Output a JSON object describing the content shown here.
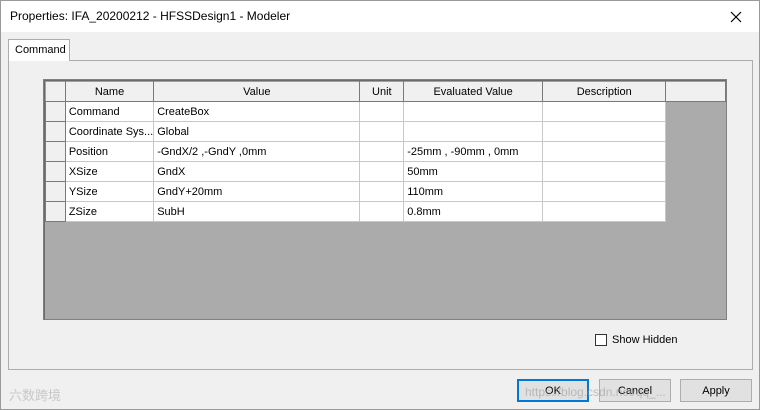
{
  "window": {
    "title": "Properties: IFA_20200212 - HFSSDesign1 - Modeler",
    "close_glyph": "✕"
  },
  "tabs": [
    {
      "label": "Command",
      "selected": true
    }
  ],
  "grid": {
    "columns": [
      "Name",
      "Value",
      "Unit",
      "Evaluated Value",
      "Description"
    ],
    "rows": [
      {
        "name": "Command",
        "value": "CreateBox",
        "unit": "",
        "evaluated": "",
        "description": ""
      },
      {
        "name": "Coordinate Sys...",
        "value": "Global",
        "unit": "",
        "evaluated": "",
        "description": ""
      },
      {
        "name": "Position",
        "value": "-GndX/2 ,-GndY ,0mm",
        "unit": "",
        "evaluated": "-25mm , -90mm , 0mm",
        "description": ""
      },
      {
        "name": "XSize",
        "value": "GndX",
        "unit": "",
        "evaluated": "50mm",
        "description": ""
      },
      {
        "name": "YSize",
        "value": "GndY+20mm",
        "unit": "",
        "evaluated": "110mm",
        "description": ""
      },
      {
        "name": "ZSize",
        "value": "SubH",
        "unit": "",
        "evaluated": "0.8mm",
        "description": ""
      }
    ]
  },
  "show_hidden": {
    "label": "Show Hidden",
    "checked": false
  },
  "buttons": {
    "ok": "OK",
    "cancel": "Cancel",
    "apply": "Apply"
  },
  "watermark": {
    "text": "六数跨境",
    "url_text": "https://blog.csdn.net/qq_..."
  }
}
